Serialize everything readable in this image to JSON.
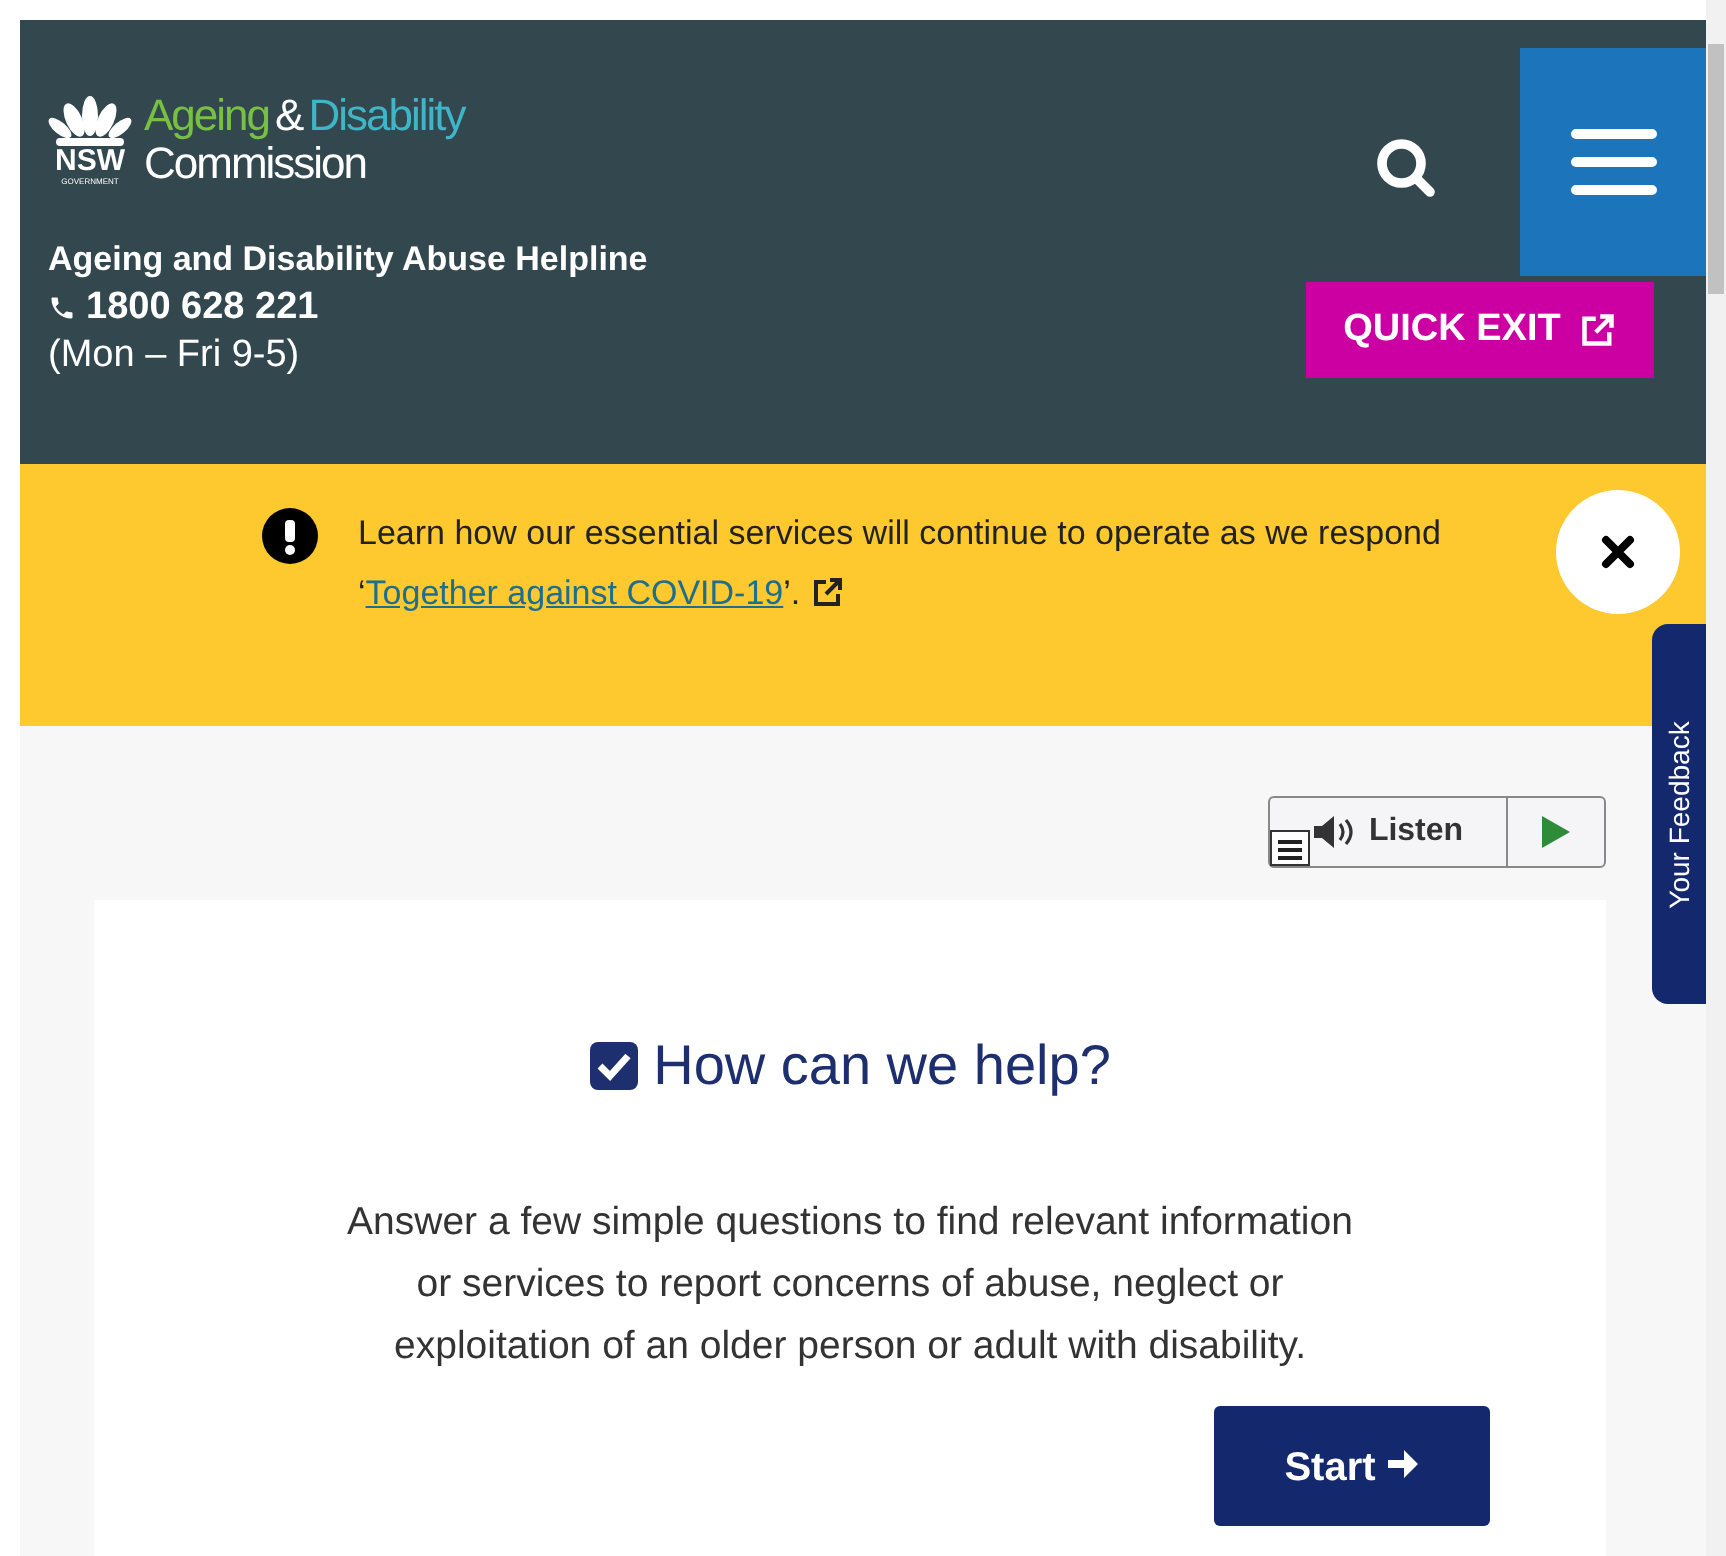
{
  "header": {
    "logo": {
      "nsw": "NSW",
      "government": "GOVERNMENT",
      "word_1": "Ageing",
      "ampersand": "&",
      "word_2": "Disability",
      "line_2": "Commission"
    },
    "helpline": {
      "title": "Ageing and Disability Abuse Helpline",
      "phone": "1800 628 221",
      "hours": "(Mon – Fri 9-5)"
    },
    "quick_exit": "QUICK EXIT"
  },
  "alert": {
    "text_before": "Learn how our essential services will continue to operate as we respond ‘",
    "link": "Together against COVID-19",
    "text_after": "’."
  },
  "listen": {
    "label": "Listen"
  },
  "feedback_tab": "Your Feedback",
  "card": {
    "title": "How can we help?",
    "body": "Answer a few simple questions to find relevant information or services to report concerns of abuse, neglect or exploitation of an older person or adult with disability.",
    "button": "Start"
  }
}
